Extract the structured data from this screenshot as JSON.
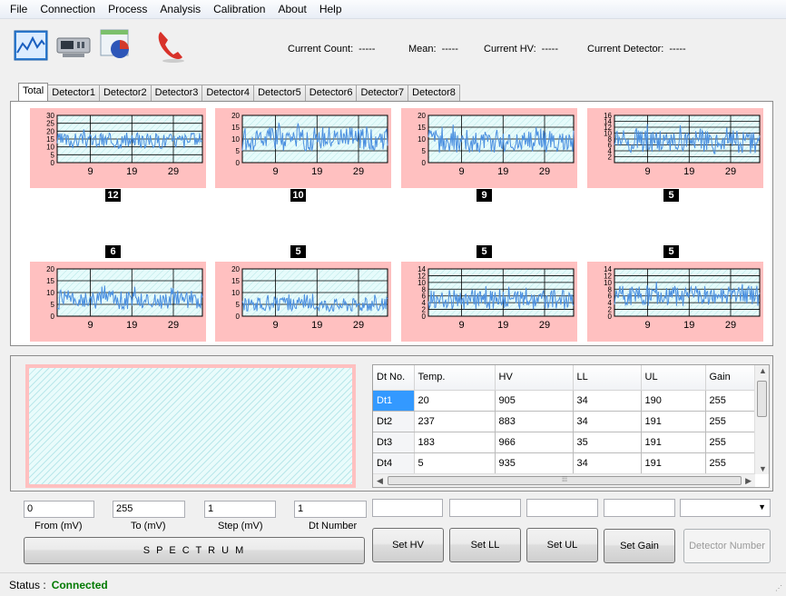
{
  "menu": [
    "File",
    "Connection",
    "Process",
    "Analysis",
    "Calibration",
    "About",
    "Help"
  ],
  "toolbar": {
    "icons": [
      "line-chart-icon",
      "device-icon",
      "pie-chart-window-icon",
      "phone-icon"
    ],
    "stats": [
      {
        "label": "Current Count:",
        "value": "-----"
      },
      {
        "label": "Mean:",
        "value": "-----"
      },
      {
        "label": "Current HV:",
        "value": "-----"
      },
      {
        "label": "Current Detector:",
        "value": "-----"
      }
    ]
  },
  "tabs": [
    "Total",
    "Detector1",
    "Detector2",
    "Detector3",
    "Detector4",
    "Detector5",
    "Detector6",
    "Detector7",
    "Detector8"
  ],
  "active_tab": "Total",
  "chart_data": [
    {
      "type": "line",
      "badge": "12",
      "ylim": [
        0,
        30
      ],
      "yticks": [
        0,
        5,
        10,
        15,
        20,
        25,
        30
      ],
      "xticks": [
        9,
        19,
        29
      ],
      "x": [
        1,
        36
      ],
      "mean": 14,
      "amplitude": 5,
      "line_color": "#4a8fe0"
    },
    {
      "type": "line",
      "badge": "10",
      "ylim": [
        0,
        20
      ],
      "yticks": [
        0,
        5,
        10,
        15,
        20
      ],
      "xticks": [
        9,
        19,
        29
      ],
      "x": [
        1,
        36
      ],
      "mean": 10,
      "amplitude": 5,
      "line_color": "#4a8fe0"
    },
    {
      "type": "line",
      "badge": "9",
      "ylim": [
        0,
        20
      ],
      "yticks": [
        0,
        5,
        10,
        15,
        20
      ],
      "xticks": [
        9,
        19,
        29
      ],
      "x": [
        1,
        36
      ],
      "mean": 9,
      "amplitude": 5,
      "line_color": "#4a8fe0"
    },
    {
      "type": "line",
      "badge": "5",
      "ylim": [
        0,
        16
      ],
      "yticks": [
        2,
        4,
        6,
        8,
        10,
        12,
        14,
        16
      ],
      "xticks": [
        9,
        19,
        29
      ],
      "x": [
        1,
        36
      ],
      "mean": 7,
      "amplitude": 4,
      "line_color": "#4a8fe0"
    },
    {
      "type": "line",
      "badge": "6",
      "ylim": [
        0,
        20
      ],
      "yticks": [
        0,
        5,
        10,
        15,
        20
      ],
      "xticks": [
        9,
        19,
        29
      ],
      "x": [
        1,
        36
      ],
      "mean": 7,
      "amplitude": 4,
      "line_color": "#4a8fe0"
    },
    {
      "type": "line",
      "badge": "5",
      "ylim": [
        0,
        20
      ],
      "yticks": [
        0,
        5,
        10,
        15,
        20
      ],
      "xticks": [
        9,
        19,
        29
      ],
      "x": [
        1,
        36
      ],
      "mean": 5,
      "amplitude": 3,
      "line_color": "#4a8fe0"
    },
    {
      "type": "line",
      "badge": "5",
      "ylim": [
        0,
        14
      ],
      "yticks": [
        0,
        2,
        4,
        6,
        8,
        10,
        12,
        14
      ],
      "xticks": [
        9,
        19,
        29
      ],
      "x": [
        1,
        36
      ],
      "mean": 5,
      "amplitude": 3,
      "line_color": "#4a8fe0"
    },
    {
      "type": "line",
      "badge": "5",
      "ylim": [
        0,
        14
      ],
      "yticks": [
        0,
        2,
        4,
        6,
        8,
        10,
        12,
        14
      ],
      "xticks": [
        9,
        19,
        29
      ],
      "x": [
        1,
        36
      ],
      "mean": 6,
      "amplitude": 3,
      "line_color": "#4a8fe0"
    }
  ],
  "grid": {
    "columns": [
      "Dt No.",
      "Temp.",
      "HV",
      "LL",
      "UL",
      "Gain"
    ],
    "rows": [
      [
        "Dt1",
        "20",
        "905",
        "34",
        "190",
        "255"
      ],
      [
        "Dt2",
        "237",
        "883",
        "34",
        "191",
        "255"
      ],
      [
        "Dt3",
        "183",
        "966",
        "35",
        "191",
        "255"
      ],
      [
        "Dt4",
        "5",
        "935",
        "34",
        "191",
        "255"
      ]
    ],
    "selected_row": "Dt1"
  },
  "spectrum": {
    "from": "0",
    "to": "255",
    "step": "1",
    "dt_number": "1",
    "from_label": "From (mV)",
    "to_label": "To (mV)",
    "step_label": "Step (mV)",
    "dt_label": "Dt Number",
    "button": "S P E C T R U M"
  },
  "actions": [
    "Set HV",
    "Set LL",
    "Set UL",
    "Set Gain",
    "Detector Number"
  ],
  "status": {
    "label": "Status :",
    "value": "Connected"
  },
  "colors": {
    "chart_bg": "#ffc0c0",
    "plot_bg": "#e9fbfb",
    "line": "#4a8fe0",
    "status": "#007a00",
    "selection": "#3399ff"
  }
}
